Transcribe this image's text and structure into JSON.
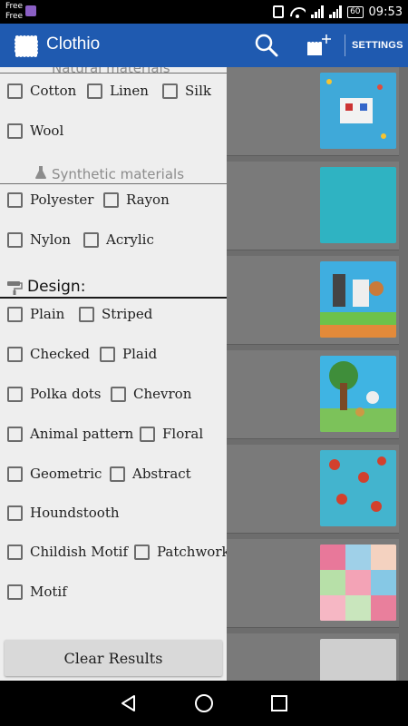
{
  "status_bar": {
    "carrier_lines": [
      "Free",
      "Free"
    ],
    "battery": "60",
    "time": "09:53"
  },
  "app_bar": {
    "title": "Clothio",
    "settings_label": "SETTINGS",
    "icons": [
      "fabric-logo-icon",
      "search-icon",
      "add-fabric-icon"
    ],
    "color": "#1f5ab0"
  },
  "drawer": {
    "natural": {
      "label": "Natural materials",
      "options": [
        "Cotton",
        "Linen",
        "Silk",
        "Wool"
      ]
    },
    "synthetic": {
      "label": "Synthetic materials",
      "options": [
        "Polyester",
        "Rayon",
        "Nylon",
        "Acrylic"
      ]
    },
    "design": {
      "label": "Design:",
      "options": [
        "Plain",
        "Striped",
        "Checked",
        "Plaid",
        "Polka dots",
        "Chevron",
        "Animal pattern",
        "Floral",
        "Geometric",
        "Abstract",
        "Houndstooth",
        "Childish Motif",
        "Patchwork",
        "Motif"
      ]
    },
    "clear_label": "Clear Results"
  },
  "results": {
    "count_visible": 7
  }
}
